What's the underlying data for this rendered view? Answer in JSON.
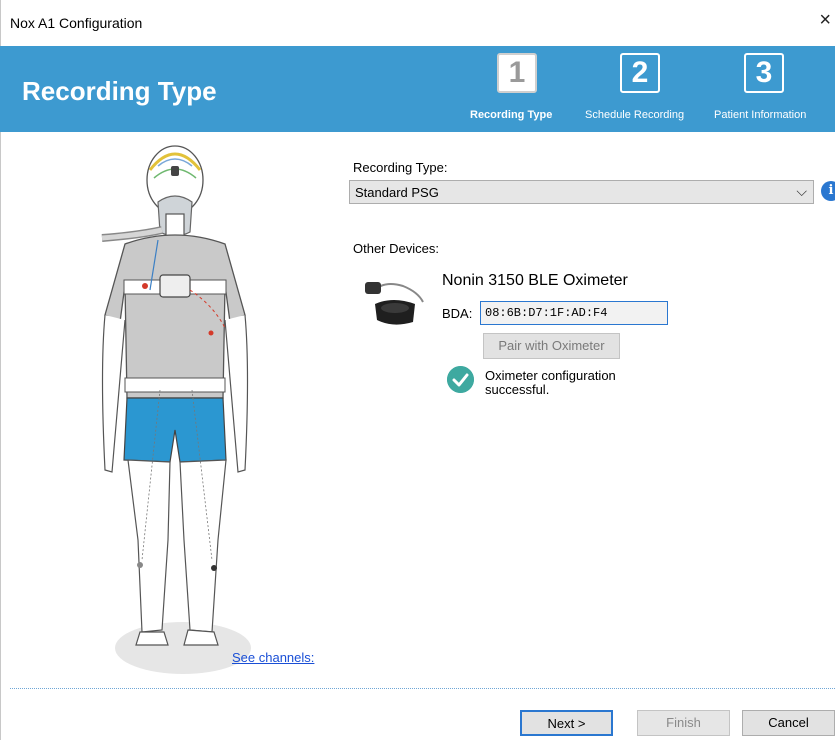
{
  "window": {
    "title": "Nox A1 Configuration",
    "close_glyph": "×"
  },
  "header": {
    "heading": "Recording Type",
    "steps": [
      {
        "number": "1",
        "label": "Recording Type",
        "active": true
      },
      {
        "number": "2",
        "label": "Schedule Recording",
        "active": false
      },
      {
        "number": "3",
        "label": "Patient Information",
        "active": false
      }
    ],
    "color": "#3d9ad0"
  },
  "left": {
    "see_channels": "See channels:"
  },
  "form": {
    "recording_type_label": "Recording Type:",
    "recording_type_value": "Standard PSG",
    "info_glyph": "i",
    "other_devices_label": "Other Devices:",
    "device": {
      "name": "Nonin 3150 BLE Oximeter",
      "bda_label": "BDA:",
      "bda_value": "08:6B:D7:1F:AD:F4",
      "pair_button": "Pair with Oximeter",
      "status_text": "Oximeter configuration successful."
    }
  },
  "footer": {
    "next": "Next >",
    "finish": "Finish",
    "cancel": "Cancel"
  }
}
